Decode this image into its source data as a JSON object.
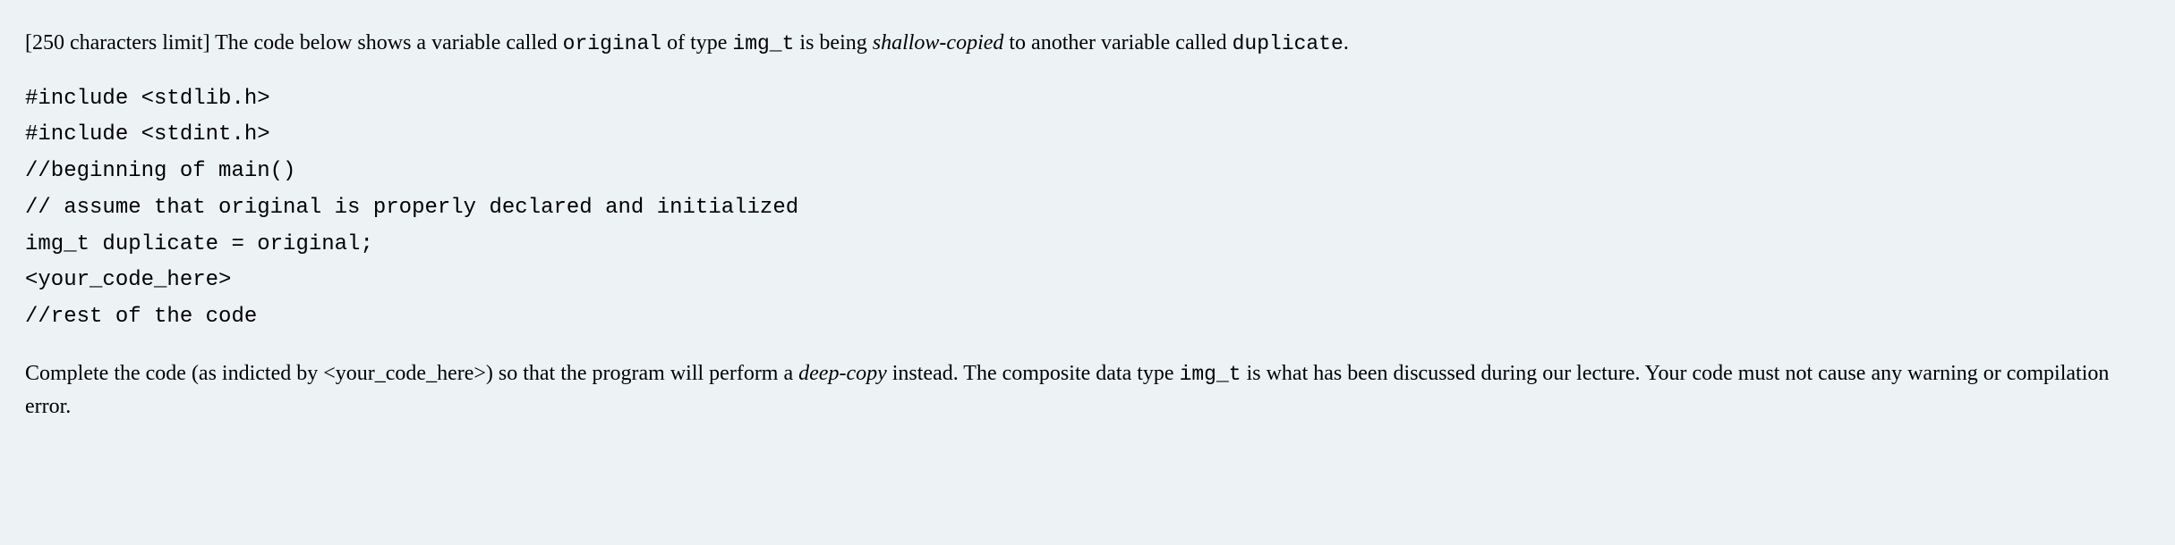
{
  "intro": {
    "prefix": "[250 characters limit] The code below shows a variable called ",
    "code1": "original",
    "mid1": " of type ",
    "code2": "img_t",
    "mid2": " is being ",
    "italic1": "shallow-copied",
    "mid3": " to another variable called ",
    "code3": "duplicate",
    "suffix": "."
  },
  "code": {
    "line1": "#include <stdlib.h>",
    "line2": "#include <stdint.h>",
    "line3": "//beginning of main()",
    "line4": "// assume that original is properly declared and initialized",
    "line5": "img_t duplicate = original;",
    "line6": "<your_code_here>",
    "line7": "//rest of the code"
  },
  "outro": {
    "part1": "Complete the code (as indicted by <your_code_here>) so that the program will perform a ",
    "italic1": "deep-copy",
    "part2": " instead. The composite data type ",
    "code1": "img_t",
    "part3": " is what has been discussed during our lecture. Your code must not cause any warning or compilation error."
  }
}
